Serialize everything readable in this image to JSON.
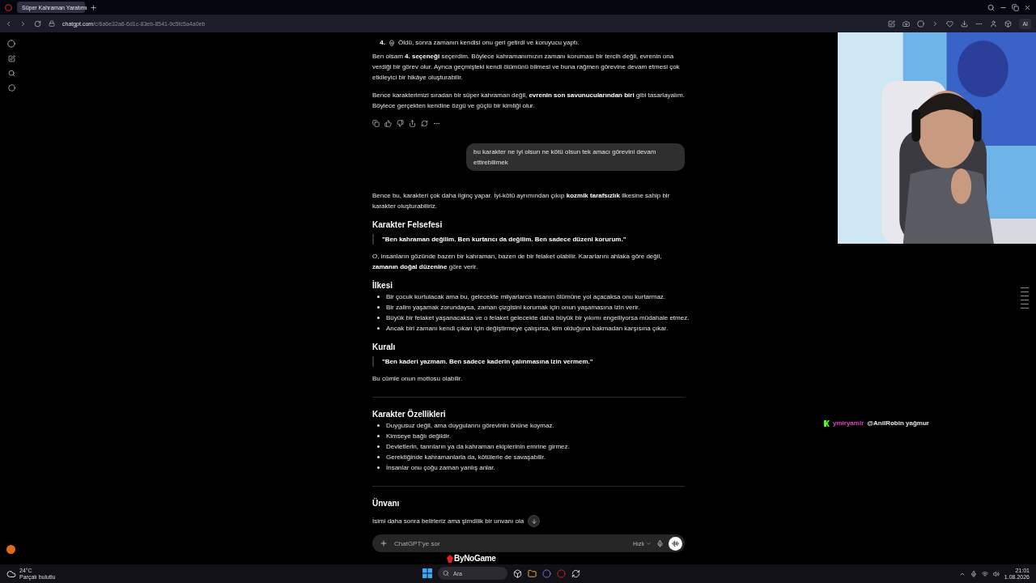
{
  "browser": {
    "tab_title": "Süper Kahraman Yaratımı",
    "url_host": "chatgpt.com",
    "url_path": "/c/6a6e32a6-6d1c-83eb-8541-9c5fc5a4a0eb",
    "ai_label": "AI"
  },
  "chat": {
    "blocks": [
      {
        "kind": "numbered",
        "number": "4.",
        "text": "Öldü, sonra zamanın kendisi onu geri getirdi ve koruyucu yaptı."
      },
      {
        "kind": "paragraph",
        "text": "Ben olsam **4. seçeneği** seçerdim. Böylece kahramanımızın zamanı koruması bir tercih değil, evrenin ona verdiği bir görev olur. Ayrıca geçmişteki kendi ölümünü bilmesi ve buna rağmen görevine devam etmesi çok etkileyici bir hikâye oluşturabilir."
      },
      {
        "kind": "paragraph",
        "text": "Bence karakterimizi sıradan bir süper kahraman değil, **evrenin son savunucularından biri** gibi tasarlayalım. Böylece gerçekten kendine özgü ve güçlü bir kimliği olur."
      },
      {
        "kind": "actions"
      },
      {
        "kind": "user_message",
        "text": "bu karakter ne iyi olsun ne kötü olsun tek amacı görevini devam ettirebilimek"
      },
      {
        "kind": "paragraph",
        "text": "Bence bu, karakteri çok daha ilginç yapar. İyi-kötü ayrımından çıkıp **kozmik tarafsızlık** ilkesine sahip bir karakter oluşturabiliriz."
      },
      {
        "kind": "heading",
        "text": "Karakter Felsefesi"
      },
      {
        "kind": "quote",
        "text": "\"Ben kahraman değilim. Ben kurtarıcı da değilim. Ben sadece düzeni korurum.\""
      },
      {
        "kind": "paragraph",
        "text": "O, insanların gözünde bazen bir kahraman, bazen de bir felaket olabilir. Kararlarını ahlaka göre değil, **zamanın doğal düzenine** göre verir."
      },
      {
        "kind": "heading",
        "text": "İlkesi"
      },
      {
        "kind": "bullets",
        "items": [
          "Bir çocuk kurtulacak ama bu, gelecekte milyarlarca insanın ölümüne yol açacaksa onu kurtarmaz.",
          "Bir zalim yaşamak zorundaysa, zaman çizgisini korumak için onun yaşamasına izin verir.",
          "Büyük bir felaket yaşanacaksa ve o felaket gelecekte daha büyük bir yıkımı engelliyorsa müdahale etmez.",
          "Ancak biri zamanı kendi çıkarı için değiştirmeye çalışırsa, kim olduğuna bakmadan karşısına çıkar."
        ]
      },
      {
        "kind": "heading",
        "text": "Kuralı"
      },
      {
        "kind": "quote",
        "text": "\"Ben kaderi yazmam. Ben sadece kaderin çalınmasına izin vermem.\""
      },
      {
        "kind": "paragraph",
        "text": "Bu cümle onun mottosu olabilir."
      },
      {
        "kind": "divider"
      },
      {
        "kind": "heading",
        "text": "Karakter Özellikleri"
      },
      {
        "kind": "bullets",
        "items": [
          "Duygusuz değil, ama duygularını görevinin önüne koymaz.",
          "Kimseye bağlı değildir.",
          "Devletlerin, tanrıların ya da kahraman ekiplerinin emrine girmez.",
          "Gerektiğinde kahramanlarla da, kötülerle de savaşabilir.",
          "İnsanlar onu çoğu zaman yanlış anlar."
        ]
      },
      {
        "kind": "divider"
      },
      {
        "kind": "heading",
        "text": "Ünvanı"
      },
      {
        "kind": "paragraph",
        "text": "İsimi daha sonra belirleriz ama şimdilik bir unvanı ola"
      }
    ]
  },
  "composer": {
    "placeholder": "ChatGPT'ye sor",
    "model": "Hızlı"
  },
  "stream_chat": {
    "user": "ymiryamir",
    "message": "@AnilRobin yağmur",
    "color": "#e040c0"
  },
  "brand": "ByNoGame",
  "taskbar": {
    "temperature": "24°C",
    "weather": "Parçalı bulutlu",
    "search": "Ara",
    "time": "21:01",
    "date": "1.08.2026"
  }
}
